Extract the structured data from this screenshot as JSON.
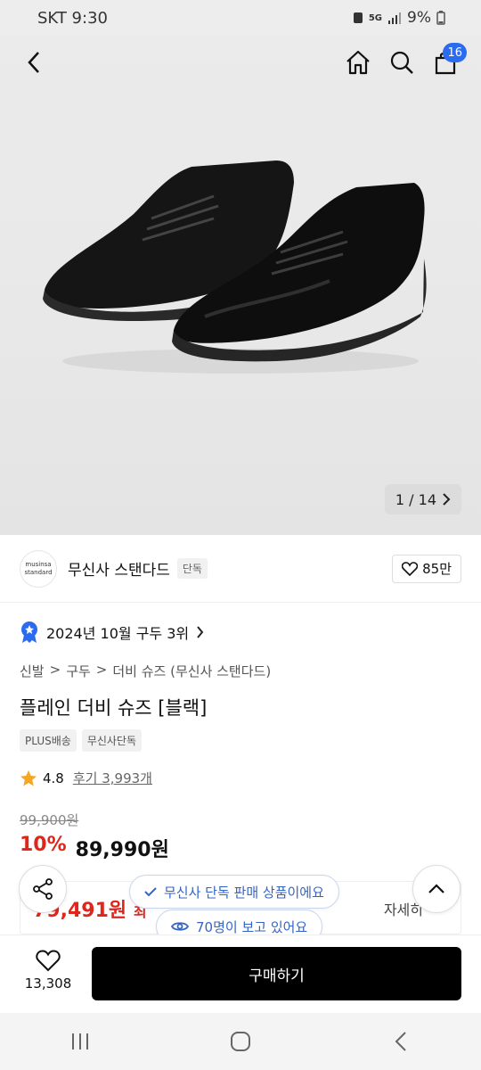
{
  "status": {
    "carrier_time": "SKT 9:30",
    "network": "5G",
    "battery": "9%"
  },
  "hero": {
    "page_indicator": "1 / 14"
  },
  "header": {
    "cart_count": "16"
  },
  "brand": {
    "logo_line1": "musinsa",
    "logo_line2": "standard",
    "name": "무신사 스탠다드",
    "badge": "단독",
    "likes": "85만"
  },
  "rank": {
    "text": "2024년 10월 구두 3위"
  },
  "breadcrumb": [
    "신발",
    "구두",
    "더비 슈즈 (무신사 스탠다드)"
  ],
  "breadcrumb_sep": ">",
  "product": {
    "title": "플레인 더비 슈즈 [블랙]",
    "chips": [
      "PLUS배송",
      "무신사단독"
    ],
    "rating": "4.8",
    "reviews": "후기 3,993개",
    "original_price": "99,900원",
    "discount": "10%",
    "price": "89,990원"
  },
  "benefit": {
    "price": "79,491원",
    "suffix": "최",
    "detail": "자세히"
  },
  "floating": {
    "exclusive_pill": "무신사 단독 판매 상품이에요",
    "viewers_pill": "70명이 보고 있어요"
  },
  "bottom": {
    "wish_count": "13,308",
    "buy_label": "구매하기"
  },
  "colors": {
    "accent_blue": "#2a6bf0",
    "discount_red": "#e0251b",
    "buy_bg": "#000000"
  }
}
